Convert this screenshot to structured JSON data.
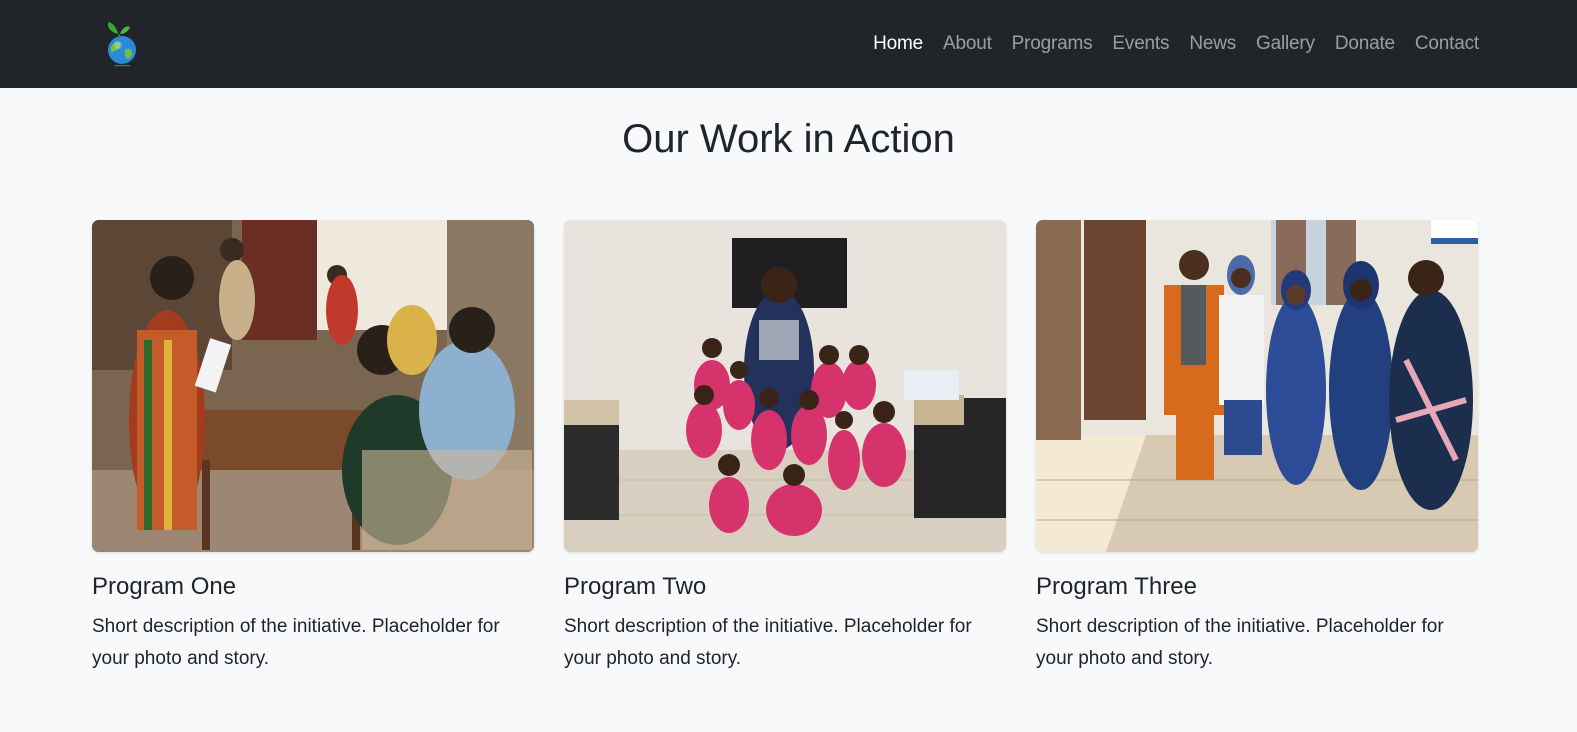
{
  "nav": {
    "logo_name": "globe-sprout-logo",
    "links": [
      {
        "label": "Home",
        "active": true
      },
      {
        "label": "About"
      },
      {
        "label": "Programs"
      },
      {
        "label": "Events"
      },
      {
        "label": "News"
      },
      {
        "label": "Gallery"
      },
      {
        "label": "Donate"
      },
      {
        "label": "Contact"
      }
    ]
  },
  "section": {
    "title": "Our Work in Action"
  },
  "cards": [
    {
      "title": "Program One",
      "text": "Short description of the initiative. Placeholder for your photo and story.",
      "image": "photo-community-gathering"
    },
    {
      "title": "Program Two",
      "text": "Short description of the initiative. Placeholder for your photo and story.",
      "image": "photo-children-group"
    },
    {
      "title": "Program Three",
      "text": "Short description of the initiative. Placeholder for your photo and story.",
      "image": "photo-adults-group"
    }
  ],
  "colors": {
    "navbar_bg": "#212529",
    "page_bg": "#f8f9fa",
    "text": "#212529"
  }
}
